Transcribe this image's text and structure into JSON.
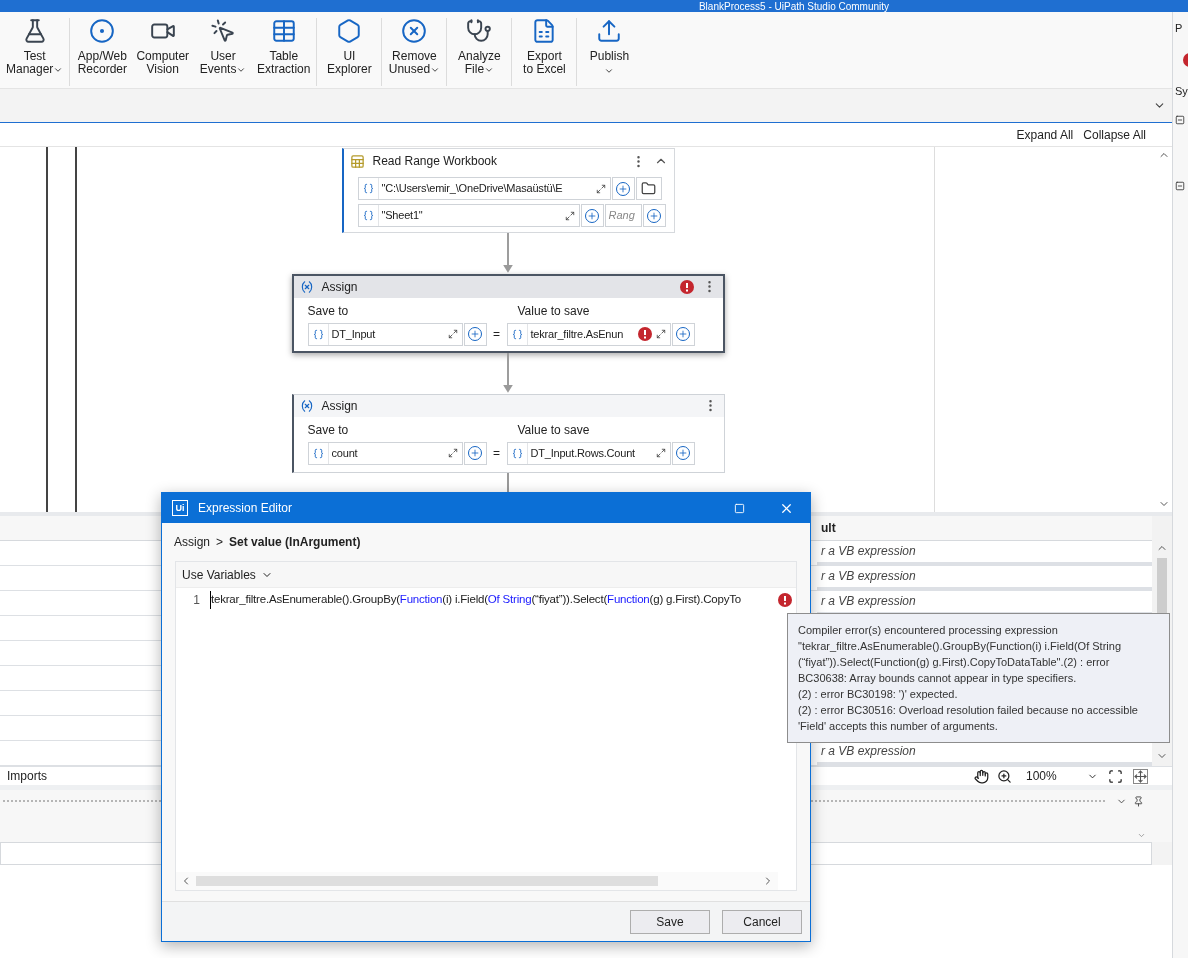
{
  "window": {
    "title": "BlankProcess5 - UiPath Studio Community"
  },
  "ribbon": {
    "groups": [
      [
        {
          "lines": [
            "Test",
            "Manager"
          ],
          "dropdown": true
        }
      ],
      [
        {
          "lines": [
            "App/Web",
            "Recorder"
          ],
          "dropdown": false
        },
        {
          "lines": [
            "Computer",
            "Vision"
          ],
          "dropdown": false
        },
        {
          "lines": [
            "User",
            "Events"
          ],
          "dropdown": true
        },
        {
          "lines": [
            "Table",
            "Extraction"
          ],
          "dropdown": false
        }
      ],
      [
        {
          "lines": [
            "UI",
            "Explorer"
          ],
          "dropdown": false
        }
      ],
      [
        {
          "lines": [
            "Remove",
            "Unused"
          ],
          "dropdown": true
        }
      ],
      [
        {
          "lines": [
            "Analyze",
            "File"
          ],
          "dropdown": true
        }
      ],
      [
        {
          "lines": [
            "Export",
            "to Excel"
          ],
          "dropdown": false
        }
      ],
      [
        {
          "lines": [
            "Publish"
          ],
          "dropdown": true
        }
      ]
    ]
  },
  "designer": {
    "expand_all": "Expand All",
    "collapse_all": "Collapse All",
    "activities": [
      {
        "kind": "read_range",
        "title": "Read Range Workbook",
        "selected": false,
        "path": "\"C:\\Users\\emir_\\OneDrive\\Masaüstü\\E",
        "sheet": "\"Sheet1\"",
        "range_placeholder": "Rang"
      },
      {
        "kind": "assign",
        "title": "Assign",
        "selected": true,
        "error": true,
        "save_to_label": "Save to",
        "value_label": "Value to save",
        "save_to": "DT_Input",
        "equals": "=",
        "value": "tekrar_filtre.AsEnun",
        "value_error": true
      },
      {
        "kind": "assign",
        "title": "Assign",
        "selected": false,
        "error": false,
        "save_to_label": "Save to",
        "value_label": "Value to save",
        "save_to": "count",
        "equals": "=",
        "value": "DT_Input.Rows.Count",
        "value_error": false
      }
    ]
  },
  "variables_panel": {
    "default_header": "ult",
    "default_cells": [
      "r a VB expression",
      "r a VB expression",
      "r a VB expression",
      "r a VB expression"
    ],
    "imports_tab": "Imports",
    "zoom": "100%"
  },
  "right_panel": {
    "tab": "P",
    "item": "Sy"
  },
  "expression_editor": {
    "logo": "Ui",
    "title": "Expression Editor",
    "breadcrumb": [
      "Assign",
      "Set value (InArgument)"
    ],
    "separator": ">",
    "use_variables": "Use Variables",
    "line_number": "1",
    "code": [
      {
        "kind": "text",
        "text": "tekrar_filtre.AsEnumerable().GroupBy("
      },
      {
        "kind": "keyword",
        "text": "Function"
      },
      {
        "kind": "text",
        "text": "(i) i.Field("
      },
      {
        "kind": "keyword",
        "text": "Of String"
      },
      {
        "kind": "text",
        "text": "(“fiyat”)).Select("
      },
      {
        "kind": "keyword",
        "text": "Function"
      },
      {
        "kind": "text",
        "text": "(g) g.First).CopyTo"
      }
    ],
    "error": true,
    "tooltip": "Compiler error(s) encountered processing expression\n\"tekrar_filtre.AsEnumerable().GroupBy(Function(i) i.Field(Of String\n(“fiyat”)).Select(Function(g) g.First).CopyToDataTable\".(2) : error\nBC30638: Array bounds cannot appear in type specifiers.\n(2) : error BC30198: ')' expected.\n(2) : error BC30516: Overload resolution failed because no accessible\n'Field' accepts this number of arguments.",
    "save": "Save",
    "cancel": "Cancel"
  }
}
